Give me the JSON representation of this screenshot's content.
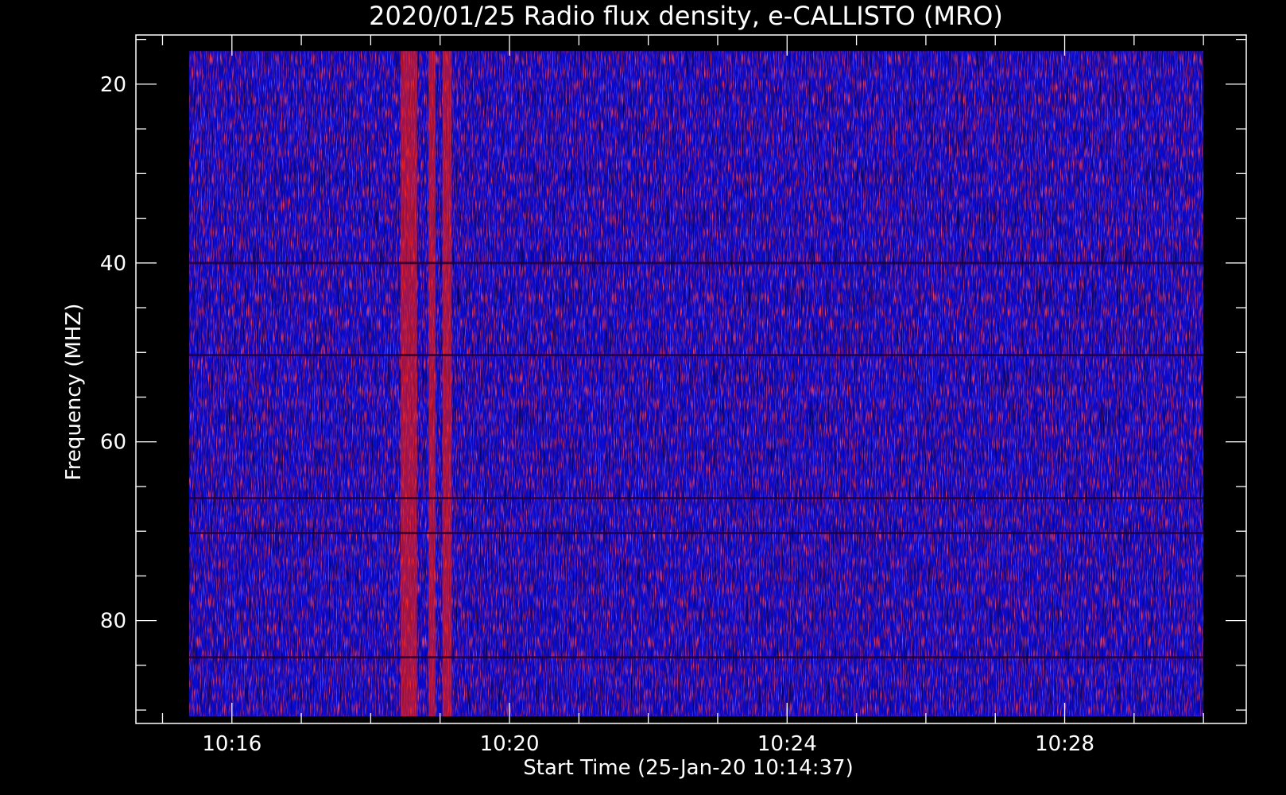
{
  "chart_data": {
    "type": "heatmap",
    "title": "2020/01/25  Radio flux density, e-CALLISTO (MRO)",
    "xlabel": "Start Time (25-Jan-20 10:14:37)",
    "ylabel": "Frequency (MHZ)",
    "x_range": [
      "10:14:37",
      "10:30:37"
    ],
    "x_ticks": [
      "10:16",
      "10:20",
      "10:24",
      "10:28"
    ],
    "y_range_mhz": [
      14.5,
      91.5
    ],
    "y_ticks": [
      20,
      40,
      60,
      80
    ],
    "y_inverted": true,
    "data_x_range": [
      "10:15:23",
      "10:30:00"
    ],
    "data_y_range_mhz": [
      16.3,
      90.7
    ],
    "colormap": [
      "#000000",
      "#0000ff",
      "#ff0000",
      "#ffff00"
    ],
    "background_color": "#0a0acd",
    "burst_bands": [
      {
        "start": "10:18:26",
        "end": "10:18:40"
      },
      {
        "start": "10:18:50",
        "end": "10:18:56"
      },
      {
        "start": "10:19:02",
        "end": "10:19:10"
      }
    ],
    "rfi_lines_mhz": [
      40.0,
      50.3,
      66.3,
      70.2,
      84.1
    ]
  }
}
